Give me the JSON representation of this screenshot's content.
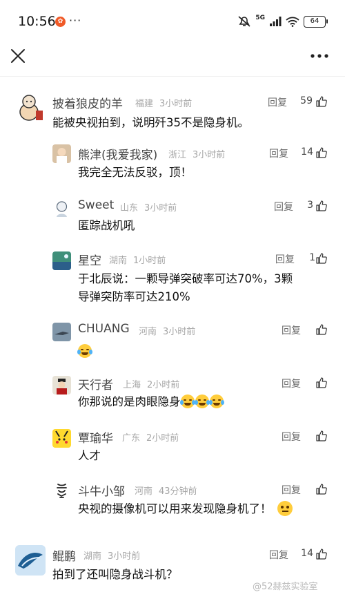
{
  "status_bar": {
    "time": "10:56",
    "more": "···",
    "network": "5G",
    "battery": "64"
  },
  "comments": [
    {
      "name": "披着狼皮的羊",
      "location": "福建",
      "time_ago": "3小时前",
      "reply_label": "回复",
      "likes": "59",
      "text": "能被央视拍到，说明歼35不是隐身机。"
    },
    {
      "name": "熊津(我爱我家)",
      "location": "浙江",
      "time_ago": "3小时前",
      "reply_label": "回复",
      "likes": "14",
      "text": "我完全无法反驳，顶！"
    },
    {
      "name": "Sweet",
      "location": "山东",
      "time_ago": "3小时前",
      "reply_label": "回复",
      "likes": "3",
      "text": "匿踪战机吼"
    },
    {
      "name": "星空",
      "location": "湖南",
      "time_ago": "1小时前",
      "reply_label": "回复",
      "likes": "1",
      "text_line1": "于北辰说：一颗导弹突破率可达70%，3颗",
      "text_line2": "导弹突防率可达210%"
    },
    {
      "name": "CHUANG",
      "location": "河南",
      "time_ago": "3小时前",
      "reply_label": "回复",
      "likes": "",
      "text_emoji": "laughing-crying"
    },
    {
      "name": "天行者",
      "location": "上海",
      "time_ago": "2小时前",
      "reply_label": "回复",
      "likes": "",
      "text": "你那说的是肉眼隐身"
    },
    {
      "name": "覃瑜华",
      "location": "广东",
      "time_ago": "2小时前",
      "reply_label": "回复",
      "likes": "",
      "text": "人才"
    },
    {
      "name": "斗牛小邹",
      "location": "河南",
      "time_ago": "43分钟前",
      "reply_label": "回复",
      "likes": "",
      "text": "央视的摄像机可以用来发现隐身机了！"
    },
    {
      "name": "鲲鹏",
      "location": "湖南",
      "time_ago": "3小时前",
      "reply_label": "回复",
      "likes": "14",
      "text": "拍到了还叫隐身战斗机？"
    }
  ],
  "watermark": "@52赫兹实验室",
  "colors": {
    "divider": "#efefef",
    "muted": "#a6a6a6",
    "text": "#111111"
  }
}
